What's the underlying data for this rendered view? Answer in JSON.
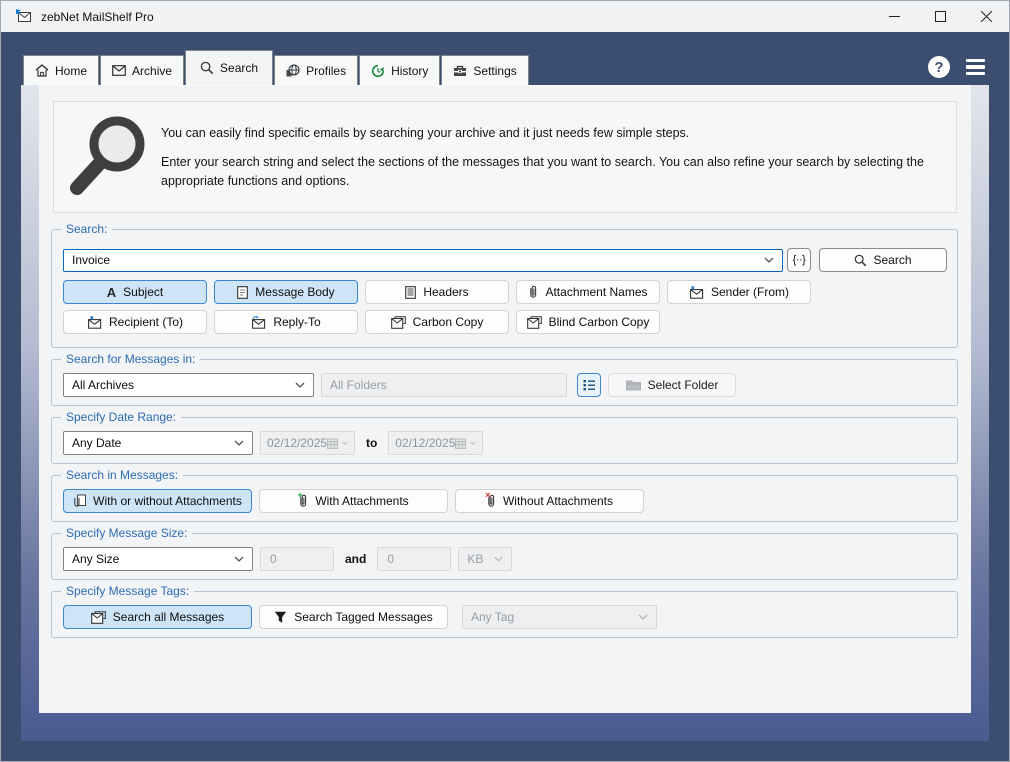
{
  "window": {
    "title": "zebNet MailShelf Pro"
  },
  "topbar": {
    "help_glyph": "?"
  },
  "tabs": [
    {
      "label": "Home",
      "active": false
    },
    {
      "label": "Archive",
      "active": false
    },
    {
      "label": "Search",
      "active": true
    },
    {
      "label": "Profiles",
      "active": false
    },
    {
      "label": "History",
      "active": false
    },
    {
      "label": "Settings",
      "active": false
    }
  ],
  "intro": {
    "paragraph1": "You can easily find specific emails by searching your archive and it just needs few simple steps.",
    "paragraph2": "Enter your search string and select the sections of the messages that you want to search. You can also refine your search by selecting the appropriate functions and options."
  },
  "sections": {
    "search": {
      "label": "Search:",
      "query": "Invoice",
      "regex_label": "{··}",
      "button_label": "Search",
      "fields_row1": [
        {
          "label": "Subject",
          "selected": true
        },
        {
          "label": "Message Body",
          "selected": true
        },
        {
          "label": "Headers",
          "selected": false
        },
        {
          "label": "Attachment Names",
          "selected": false
        },
        {
          "label": "Sender (From)",
          "selected": false
        }
      ],
      "fields_row2": [
        {
          "label": "Recipient (To)",
          "selected": false
        },
        {
          "label": "Reply-To",
          "selected": false
        },
        {
          "label": "Carbon Copy",
          "selected": false
        },
        {
          "label": "Blind Carbon Copy",
          "selected": false
        }
      ]
    },
    "location": {
      "label": "Search for Messages in:",
      "archive_value": "All Archives",
      "folder_value": "All Folders",
      "select_folder_label": "Select Folder"
    },
    "date": {
      "label": "Specify Date Range:",
      "preset_value": "Any Date",
      "from_value": "02/12/2025",
      "to_label": "to",
      "to_value": "02/12/2025"
    },
    "attachments": {
      "label": "Search in Messages:",
      "buttons": [
        {
          "label": "With or without Attachments",
          "selected": true
        },
        {
          "label": "With Attachments",
          "selected": false
        },
        {
          "label": "Without Attachments",
          "selected": false
        }
      ]
    },
    "size": {
      "label": "Specify Message Size:",
      "preset_value": "Any Size",
      "min_value": "0",
      "and_label": "and",
      "max_value": "0",
      "unit_value": "KB"
    },
    "tags": {
      "label": "Specify Message Tags:",
      "buttons": [
        {
          "label": "Search all Messages",
          "selected": true
        },
        {
          "label": "Search Tagged Messages",
          "selected": false
        }
      ],
      "tag_value": "Any Tag"
    }
  }
}
